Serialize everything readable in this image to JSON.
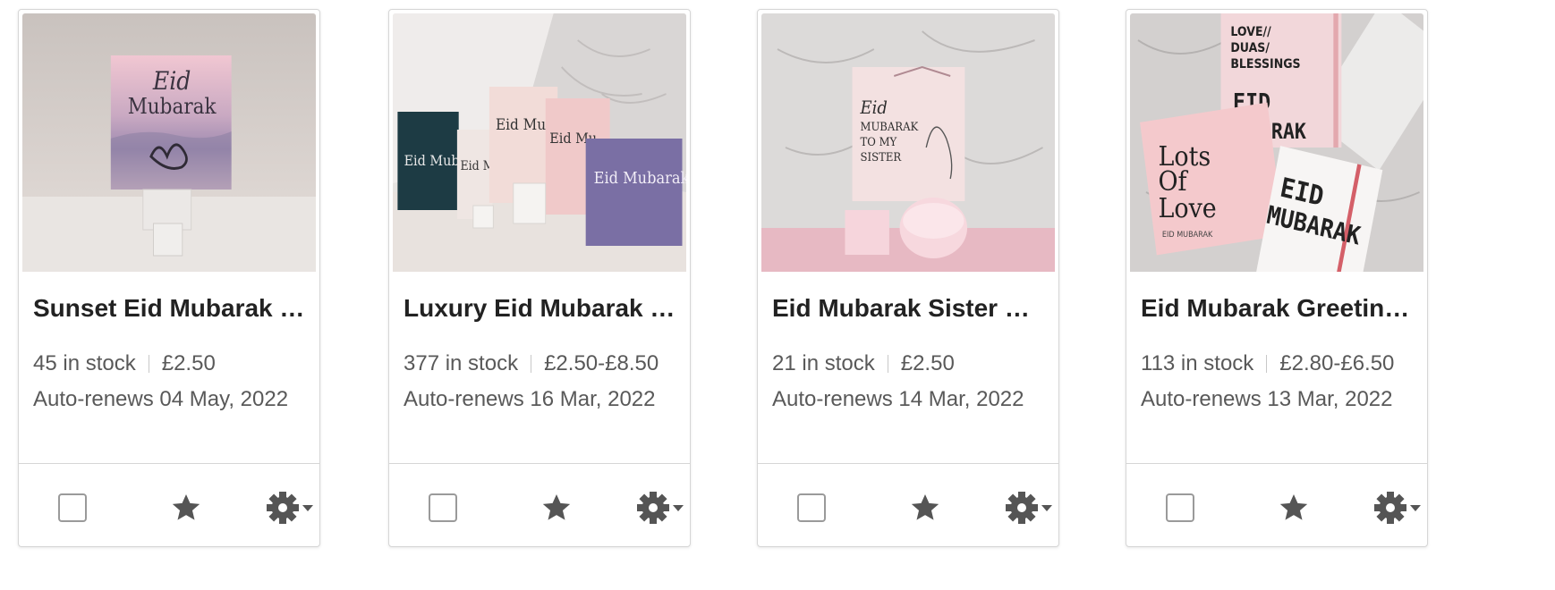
{
  "listings": [
    {
      "title": "Sunset Eid Mubarak Greeting Card",
      "stock": "45 in stock",
      "price": "£2.50",
      "renews": "Auto-renews 04 May, 2022",
      "image_text": [
        "Eid",
        "Mubarak"
      ]
    },
    {
      "title": "Luxury Eid Mubarak Greeting Card",
      "stock": "377 in stock",
      "price": "£2.50-£8.50",
      "renews": "Auto-renews 16 Mar, 2022",
      "image_text": [
        "Eid Mub",
        "Eid Mu",
        "Eid Mubarak"
      ]
    },
    {
      "title": "Eid Mubarak Sister Card",
      "stock": "21 in stock",
      "price": "£2.50",
      "renews": "Auto-renews 14 Mar, 2022",
      "image_text": [
        "Eid",
        "MUBARAK",
        "TO MY",
        "SISTER"
      ]
    },
    {
      "title": "Eid Mubarak Greeting Card",
      "stock": "113 in stock",
      "price": "£2.80-£6.50",
      "renews": "Auto-renews 13 Mar, 2022",
      "image_text": [
        "LOVE//",
        "DUAS/",
        "BLESSINGS",
        "EID",
        "MUBARAK",
        "Lots",
        "Of",
        "Love",
        "EID MUBARAK"
      ]
    }
  ],
  "colors": {
    "icon": "#555555",
    "border": "#d6d6d6",
    "secondary_text": "#595959"
  },
  "icons": {
    "feature": "star-icon",
    "settings": "gear-icon",
    "menu": "caret-down-icon"
  }
}
